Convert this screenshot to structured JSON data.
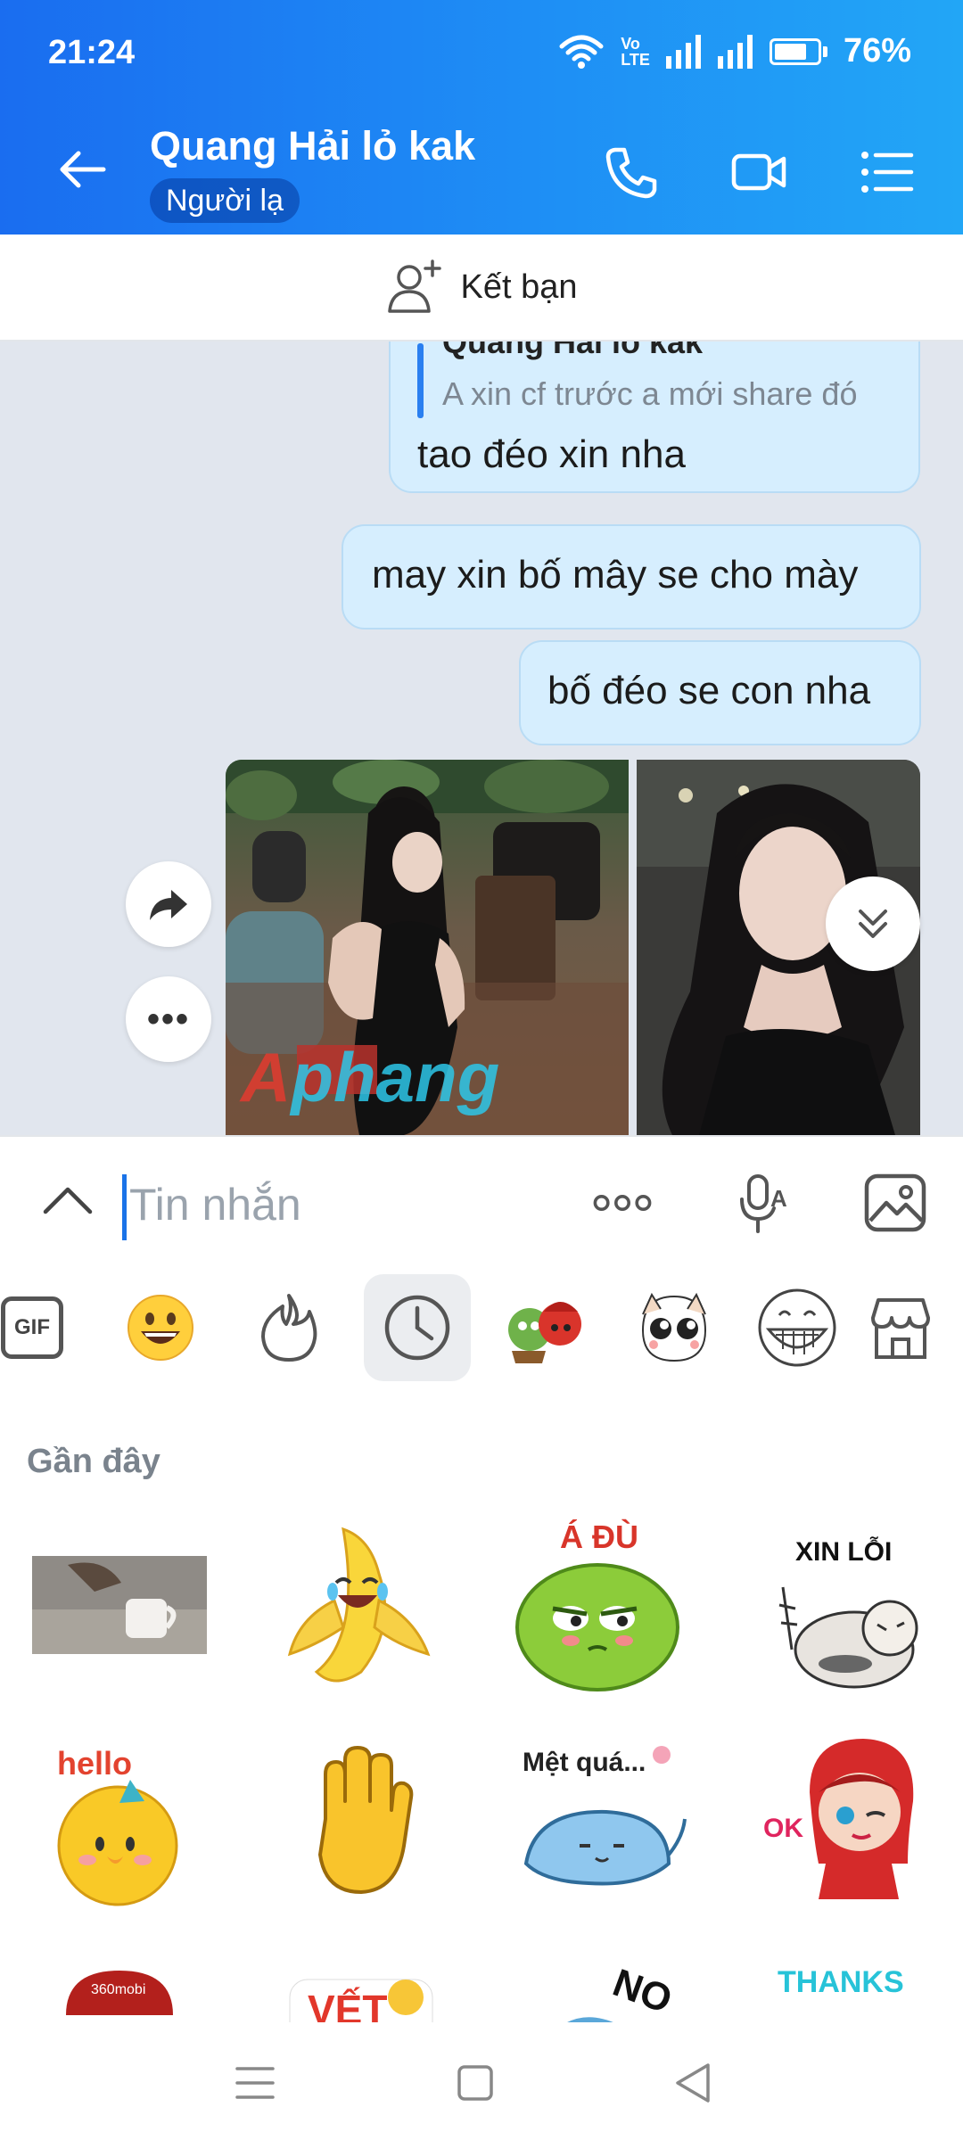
{
  "status_bar": {
    "time": "21:24",
    "network_label_top": "Vo",
    "network_label_bottom": "LTE",
    "battery_level": 0.76,
    "battery_text": "76%"
  },
  "header": {
    "title": "Quang Hải lỏ kak",
    "badge": "Người lạ",
    "icons": [
      "back-arrow-icon",
      "phone-icon",
      "video-call-icon",
      "menu-list-icon"
    ]
  },
  "add_friend": {
    "label": "Kết bạn",
    "icon": "add-person-icon"
  },
  "messages": {
    "quoted": {
      "name": "Quang Hải lỏ kak",
      "text": "A xin cf trước a mới share đó"
    },
    "items": [
      {
        "text": "tao đéo xin nha"
      },
      {
        "text": "may xin bố mây se cho mày"
      },
      {
        "text": "bố đéo se con nha"
      }
    ],
    "watermark": "phang",
    "photo_photos": [
      "woman-in-black-dress-cafe-photo",
      "woman-selfie-photo"
    ]
  },
  "composer": {
    "placeholder": "Tin nhắn",
    "icons": [
      "chevron-up-icon",
      "more-dots-icon",
      "voice-text-icon",
      "image-icon"
    ]
  },
  "sticker_tabs": {
    "gif_label": "GIF",
    "active_index": 3,
    "items": [
      "gif-icon",
      "emoji-icon",
      "fire-icon",
      "recent-clock-icon",
      "couple-sticker-pack",
      "cute-face-sticker-pack",
      "grin-sticker-pack",
      "sticker-store-icon"
    ]
  },
  "recent": {
    "title": "Gần đây",
    "stickers": [
      {
        "name": "coffee-photo-sticker",
        "caption": ""
      },
      {
        "name": "laughing-banana-sticker",
        "caption": ""
      },
      {
        "name": "green-monster-sticker",
        "caption": "Á ĐÙ"
      },
      {
        "name": "sorry-baby-sticker",
        "caption": "XIN LỖI"
      },
      {
        "name": "hello-chick-sticker",
        "caption": "hello"
      },
      {
        "name": "raised-hand-sticker",
        "caption": ""
      },
      {
        "name": "tired-whale-sticker",
        "caption": "Mệt quá..."
      },
      {
        "name": "red-hood-girl-sticker",
        "caption": "OK"
      },
      {
        "name": "cake-partial-sticker",
        "caption": "360mobi"
      },
      {
        "name": "party-partial-sticker",
        "caption": ""
      },
      {
        "name": "no-fish-partial-sticker",
        "caption": "NO"
      },
      {
        "name": "thanks-partial-sticker",
        "caption": "THANKS"
      }
    ]
  },
  "nav_bar": {
    "icons": [
      "recent-apps-icon",
      "home-square-icon",
      "back-triangle-icon"
    ]
  }
}
